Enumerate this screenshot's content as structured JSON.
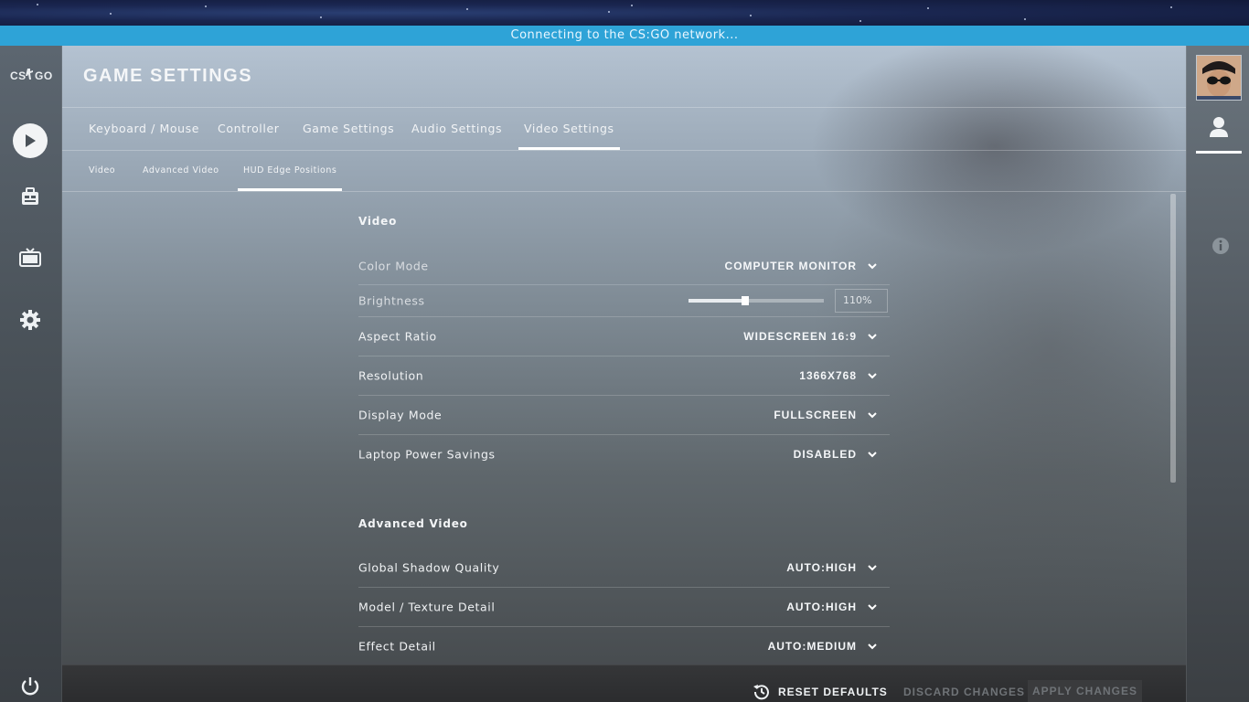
{
  "network_status": "Connecting to the CS:GO network...",
  "logo": "CS GO",
  "left_nav": [
    {
      "name": "play-icon"
    },
    {
      "name": "inventory-icon"
    },
    {
      "name": "watch-tv-icon"
    },
    {
      "name": "settings-gear-icon"
    },
    {
      "name": "power-icon"
    }
  ],
  "page_title": "GAME SETTINGS",
  "tabs": [
    {
      "label": "Keyboard / Mouse"
    },
    {
      "label": "Controller"
    },
    {
      "label": "Game Settings"
    },
    {
      "label": "Audio Settings"
    },
    {
      "label": "Video Settings",
      "active": true
    }
  ],
  "subtabs": [
    {
      "label": "Video"
    },
    {
      "label": "Advanced Video"
    },
    {
      "label": "HUD Edge Positions",
      "active": true
    }
  ],
  "sections": {
    "video": {
      "title": "Video",
      "color_mode": {
        "label": "Color Mode",
        "value": "COMPUTER MONITOR"
      },
      "brightness": {
        "label": "Brightness",
        "value": "110%",
        "level": 0.42
      },
      "aspect_ratio": {
        "label": "Aspect Ratio",
        "value": "WIDESCREEN 16:9"
      },
      "resolution": {
        "label": "Resolution",
        "value": "1366X768"
      },
      "display_mode": {
        "label": "Display Mode",
        "value": "FULLSCREEN"
      },
      "power_savings": {
        "label": "Laptop Power Savings",
        "value": "DISABLED"
      }
    },
    "advanced": {
      "title": "Advanced Video",
      "shadow": {
        "label": "Global Shadow Quality",
        "value": "AUTO:HIGH"
      },
      "texture": {
        "label": "Model / Texture Detail",
        "value": "AUTO:HIGH"
      },
      "effect": {
        "label": "Effect Detail",
        "value": "AUTO:MEDIUM"
      }
    }
  },
  "buttons": {
    "reset": "RESET DEFAULTS",
    "discard": "DISCARD CHANGES",
    "apply": "APPLY CHANGES"
  },
  "colors": {
    "network_bar": "#2ea3d7",
    "text": "#ffffff",
    "disabled": "#6f7377"
  }
}
